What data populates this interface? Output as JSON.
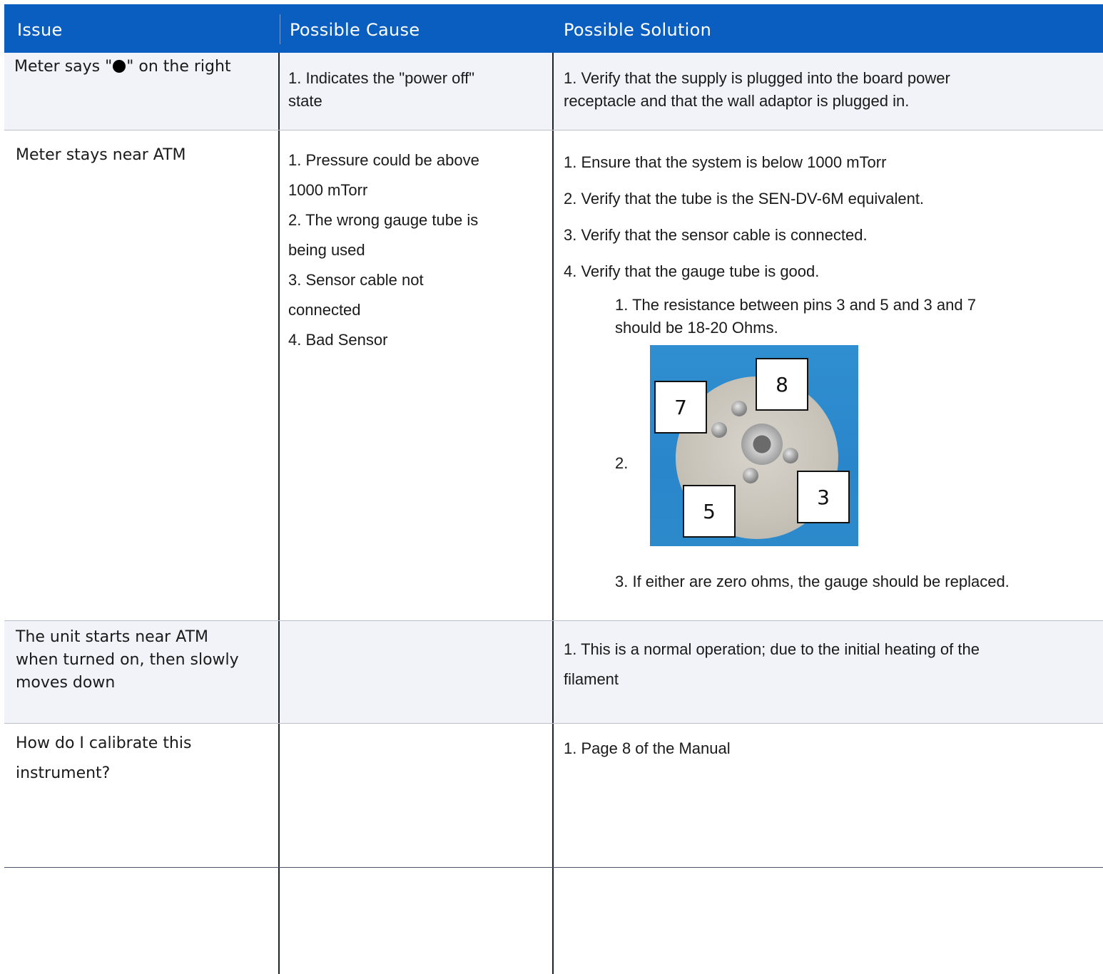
{
  "header": {
    "col_issue": "Issue",
    "col_cause": "Possible Cause",
    "col_solution": "Possible Solution"
  },
  "rows": [
    {
      "issue_before": "Meter says \"",
      "issue_after": "\" on the right",
      "cause": [
        "1. Indicates the \"power off\"",
        "state"
      ],
      "solution": [
        "1. Verify that the supply is plugged into the board power",
        "receptacle and that the wall adaptor is plugged in."
      ]
    },
    {
      "issue": "Meter stays near ATM",
      "cause": [
        "1. Pressure could be above",
        "1000 mTorr",
        "2. The wrong gauge tube is",
        "being used",
        "3. Sensor cable not",
        "connected",
        "4. Bad Sensor"
      ],
      "solution": [
        "1. Ensure that the system is below 1000 mTorr",
        "2. Verify that the tube is the SEN-DV-6M equivalent.",
        "3. Verify that the sensor cable is connected.",
        "4. Verify that the gauge tube is good."
      ],
      "sub_steps": {
        "step1": [
          "1. The resistance between pins 3 and 5 and 3 and 7",
          "should be 18-20 Ohms."
        ],
        "step2": "2.",
        "step3": "3. If either are zero ohms, the gauge should be replaced."
      },
      "pin_labels": [
        "8",
        "7",
        "3",
        "5"
      ]
    },
    {
      "issue": [
        "The unit starts near ATM",
        "when turned on, then slowly",
        "moves down"
      ],
      "cause": "",
      "solution": [
        "1. This is a normal operation; due to the initial heating of the",
        "filament"
      ]
    },
    {
      "issue": [
        "How do I calibrate this",
        "instrument?"
      ],
      "cause": "",
      "solution": "1. Page 8 of the Manual"
    },
    {
      "issue": "",
      "cause": "",
      "solution": ""
    }
  ]
}
